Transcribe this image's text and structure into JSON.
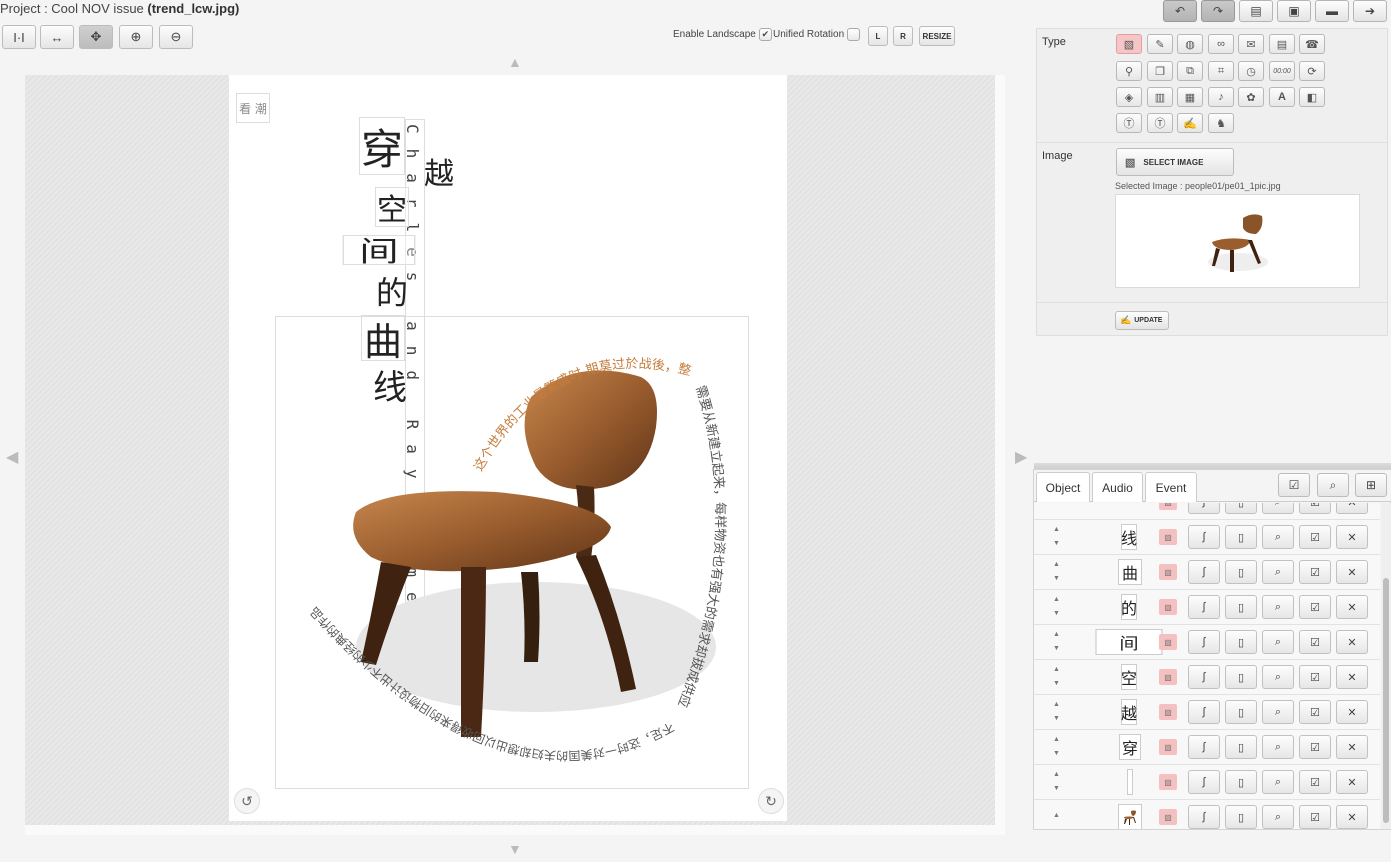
{
  "title": {
    "prefix": "Project : Cool NOV issue ",
    "file": "(trend_lcw.jpg)"
  },
  "top_actions": [
    "undo",
    "redo",
    "new-page",
    "paste",
    "save",
    "next"
  ],
  "toolbar": {
    "enable_landscape": "Enable Landscape",
    "enable_landscape_checked": true,
    "unified_rotation": "Unified Rotation",
    "unified_rotation_checked": false,
    "l_label": "L",
    "r_label": "R",
    "resize_label": "RESIZE"
  },
  "canvas": {
    "vertical_title": [
      "穿",
      "越",
      "空",
      "间",
      "的",
      "曲",
      "线"
    ],
    "corner_label": "看 潮",
    "english_vertical": "Charles and Ray Eames",
    "curved_text_top": "这个世界的工业最繁盛时 期莫过於战後，整个世界",
    "curved_text_right": "需要从新建立起来，每样物资也有强大的需求却拔成供应",
    "curved_text_bottom": "不足，这时一对美国的夫妇却想出以回收得来的旧物设计出不少的经典的作品。"
  },
  "properties": {
    "type_label": "Type",
    "image_label": "Image",
    "select_image_label": "SELECT IMAGE",
    "selected_image_text": "Selected Image : people01/pe01_1pic.jpg",
    "update_label": "UPDATE",
    "type_icons": [
      "image",
      "brush",
      "globe",
      "link",
      "mail",
      "document",
      "phone",
      "pin",
      "copy",
      "shapes",
      "crop",
      "clock",
      "timer",
      "refresh",
      "box",
      "film",
      "pages",
      "sound",
      "flower",
      "text-a",
      "puzzle",
      "textbox",
      "textbox-2",
      "edit",
      "figure"
    ],
    "timer_text": "00:00",
    "text_a": "A"
  },
  "layer_panel": {
    "tabs": [
      "Object",
      "Audio",
      "Event"
    ],
    "rows": [
      {
        "glyph": "线"
      },
      {
        "glyph": "曲"
      },
      {
        "glyph": "的"
      },
      {
        "glyph": "间"
      },
      {
        "glyph": "空"
      },
      {
        "glyph": "越"
      },
      {
        "glyph": "穿"
      },
      {
        "glyph": ""
      },
      {
        "glyph": "chair"
      }
    ]
  }
}
